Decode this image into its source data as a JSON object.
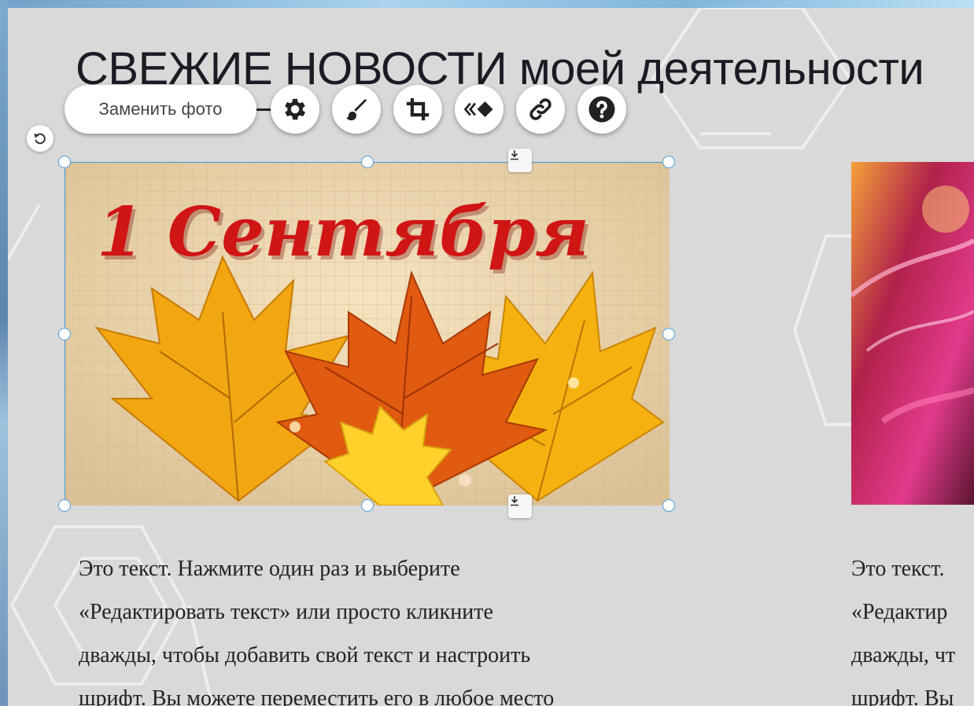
{
  "page": {
    "title": "СВЕЖИЕ НОВОСТИ моей деятельности"
  },
  "toolbar": {
    "replace_photo_label": "Заменить фото",
    "buttons": [
      {
        "icon": "gear-icon",
        "name": "settings"
      },
      {
        "icon": "brush-icon",
        "name": "design"
      },
      {
        "icon": "crop-icon",
        "name": "crop"
      },
      {
        "icon": "animation-icon",
        "name": "animation"
      },
      {
        "icon": "link-icon",
        "name": "link"
      },
      {
        "icon": "help-icon",
        "name": "help"
      }
    ]
  },
  "photo_1": {
    "caption_art": "1 Сентября"
  },
  "text_block_1": {
    "lines": [
      "Это текст. Нажмите один раз и выберите",
      "«Редактировать текст» или просто кликните",
      "дважды, чтобы добавить свой текст и настроить",
      "шрифт. Вы можете переместить его в любое место"
    ]
  },
  "text_block_2": {
    "lines": [
      "Это текст.",
      "«Редактир",
      "дважды, чт",
      "шрифт. Вы"
    ]
  },
  "colors": {
    "page_background": "#d9d9d9",
    "selection_accent": "#4a9ad8",
    "title_text": "#1b1b25",
    "caption_red": "#d01515"
  }
}
